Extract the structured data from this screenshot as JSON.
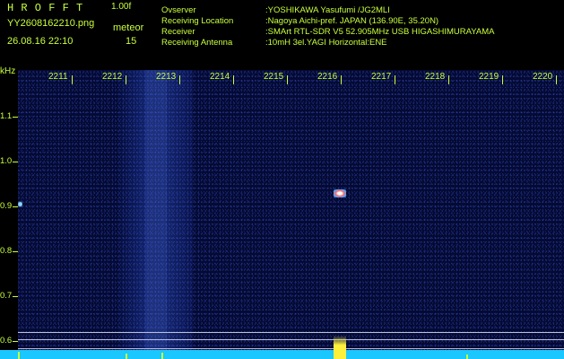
{
  "header": {
    "app_title": "H R O F F T",
    "app_version": "1.00f",
    "file_name": "YY2608162210.png",
    "date_time": "26.08.16 22:10",
    "meteor_label": "meteor",
    "meteor_count": "15",
    "info": [
      {
        "key": "Ovserver",
        "value": ":YOSHIKAWA Yasufumi /JG2MLI"
      },
      {
        "key": "Receiving Location",
        "value": ":Nagoya Aichi-pref. JAPAN (136.90E, 35.20N)"
      },
      {
        "key": "Receiver",
        "value": ":SMArt RTL-SDR V5 52.905MHz USB HIGASHIMURAYAMA"
      },
      {
        "key": "Receiving Antenna",
        "value": ":10mH 3el.YAGI Horizontal:ENE"
      }
    ]
  },
  "spectrogram": {
    "y_unit": "kHz",
    "y_ticks": [
      "1.1",
      "1.0",
      "0.9",
      "0.8",
      "0.7",
      "0.6"
    ],
    "x_ticks": [
      "2211",
      "2212",
      "2213",
      "2214",
      "2215",
      "2216",
      "2217",
      "2218",
      "2219",
      "2220"
    ],
    "colors": {
      "background": "#040a32",
      "text": "#c8ff3c",
      "noise_band": "#4f78ee",
      "bottom_trace": "#1ac8ff"
    }
  }
}
